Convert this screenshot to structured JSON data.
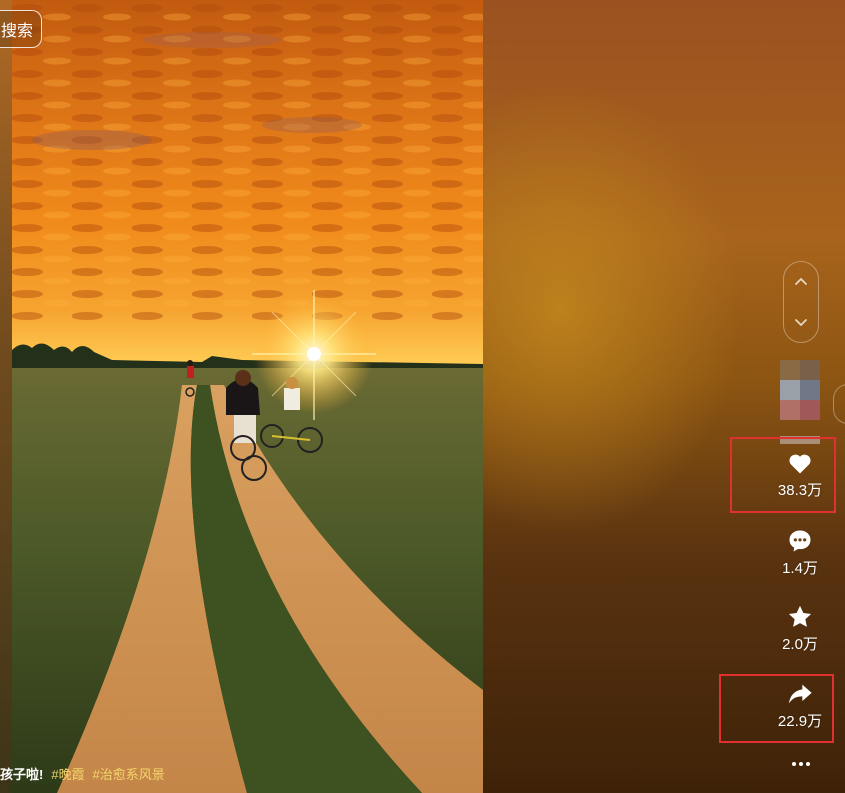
{
  "search": {
    "label": "搜索"
  },
  "caption": {
    "text": "孩子啦!",
    "tags": [
      "#晚霞",
      "#治愈系风景"
    ]
  },
  "actions": {
    "like": {
      "icon": "heart-icon",
      "count": "38.3万"
    },
    "comment": {
      "icon": "comment-icon",
      "count": "1.4万"
    },
    "favorite": {
      "icon": "star-icon",
      "count": "2.0万"
    },
    "share": {
      "icon": "share-icon",
      "count": "22.9万"
    },
    "more": {
      "icon": "more-icon"
    }
  },
  "navigation": {
    "up_icon": "chevron-up-icon",
    "down_icon": "chevron-down-icon"
  },
  "colors": {
    "highlight": "#e03030",
    "tag": "#f3d56b"
  }
}
